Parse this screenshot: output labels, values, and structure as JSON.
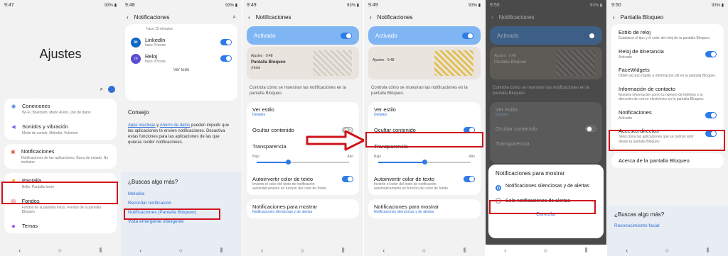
{
  "panel1": {
    "time": "9:47",
    "status_right": "93% ▮",
    "title": "Ajustes",
    "items": [
      {
        "icon": "wifi-icon",
        "glyph": "◉",
        "color": "#2f6fd6",
        "title": "Conexiones",
        "sub": "Wi-Fi, Bluetooth, Modo Avión, Uso de datos"
      },
      {
        "icon": "sound-icon",
        "glyph": "◀",
        "color": "#7a5de0",
        "title": "Sonidos y vibración",
        "sub": "Modo de sonido, Melodía, Volumen"
      },
      {
        "icon": "notification-icon",
        "glyph": "▣",
        "color": "#e0524a",
        "title": "Notificaciones",
        "sub": "Notificaciones de las aplicaciones, Barra de estado, No molestar"
      },
      {
        "icon": "brightness-icon",
        "glyph": "✹",
        "color": "#e8b92a",
        "title": "Pantalla",
        "sub": "Brillo, Pantalla Inicio"
      },
      {
        "icon": "wallpaper-icon",
        "glyph": "▤",
        "color": "#d9506f",
        "title": "Fondos",
        "sub": "Fondos de la pantalla Inicio, Fondos de la pantalla Bloqueo"
      },
      {
        "icon": "themes-icon",
        "glyph": "◆",
        "color": "#9b5de0",
        "title": "Temas",
        "sub": ""
      }
    ]
  },
  "panel2": {
    "time": "9:48",
    "status_right": "93% ▮",
    "title": "Notificaciones",
    "top_sub": "hace 15 minutos",
    "apps": [
      {
        "name": "LinkedIn",
        "sub": "hace 3 horas",
        "icon": "linkedin-icon",
        "glyph": "in",
        "color": "#0a66c2"
      },
      {
        "name": "Reloj",
        "sub": "hace 3 horas",
        "icon": "clock-icon",
        "glyph": "◷",
        "color": "#5a4bd1"
      }
    ],
    "ver_todo": "Ver todo",
    "consejo_title": "Consejo",
    "consejo_link1": "Apps inactivas",
    "consejo_y": " y ",
    "consejo_link2": "Ahorro de datos",
    "consejo_text": " pueden impedir que las aplicaciones te envíen notificaciones. Desactiva estas funciones para las aplicaciones de las que quieras recibir notificaciones.",
    "search_title": "¿Buscas algo más?",
    "links": [
      "Melodía",
      "Recordar notificación",
      "Notificaciones (Pantalla Bloqueo)",
      "Vista emergente inteligente"
    ]
  },
  "panel3": {
    "time": "9:49",
    "status_right": "93% ▮",
    "title": "Notificaciones",
    "activated": "Activado",
    "preview_app": "Ajustes · 9:48",
    "preview_title": "Pantalla Bloqueo",
    "preview_sub": "¡Hola!",
    "desc": "Controla cómo se muestran las notificaciones en la pantalla Bloqueo.",
    "ver_estilo": "Ver estilo",
    "detalles": "Detalles",
    "ocultar": "Ocultar contenido",
    "transparencia": "Transparencia",
    "bajo": "Bajo",
    "alto": "Alto",
    "slider_level": 0.34,
    "autoinvertir": "Autoinvertir color de texto",
    "autoinvertir_sub": "Invierte el color del texto de notificación automáticamente en función del color de fondo.",
    "mostrar": "Notificaciones para mostrar",
    "mostrar_sub": "Notificaciones silenciosas y de alertas"
  },
  "panel4": {
    "time": "9:49",
    "status_right": "93% ▮",
    "title": "Notificaciones",
    "slider_level": 0.5
  },
  "panel5": {
    "time": "9:50",
    "status_right": "93% ▮",
    "title": "Notificaciones",
    "sheet_title": "Notificaciones para mostrar",
    "option1": "Notificaciones silenciosas y de alertas",
    "option2": "Solo notificaciones de alertas",
    "cancel": "Cancelar"
  },
  "panel6": {
    "time": "9:50",
    "status_right": "93% ▮",
    "title": "Pantalla Bloqueo",
    "items": [
      {
        "title": "Estilo de reloj",
        "sub": "Establece el tipo y el color del reloj de la pantalla Bloqueo.",
        "toggle": false,
        "blue": false
      },
      {
        "title": "Reloj de itinerancia",
        "sub": "Activado",
        "toggle": true,
        "blue": true
      },
      {
        "title": "FaceWidgets",
        "sub": "Obtén acceso rápido a información útil en la pantalla Bloqueo.",
        "toggle": false,
        "blue": false
      },
      {
        "title": "Información de contacto",
        "sub": "Muestra información como tu número de teléfono o la dirección de correo electrónico en la pantalla Bloqueo.",
        "toggle": false,
        "blue": false
      },
      {
        "title": "Notificaciones",
        "sub": "Activado",
        "toggle": true,
        "blue": true
      },
      {
        "title": "Accesos directos",
        "sub": "Selecciona las aplicaciones que se podrán abrir desde la pantalla Bloqueo.",
        "toggle": true,
        "blue": false
      }
    ],
    "acerca": "Acerca de la pantalla Bloqueo",
    "search_title": "¿Buscas algo más?",
    "search_link": "Reconocimiento facial"
  },
  "colors": {
    "accent": "#2f7be5",
    "highlight": "#d0121b"
  }
}
